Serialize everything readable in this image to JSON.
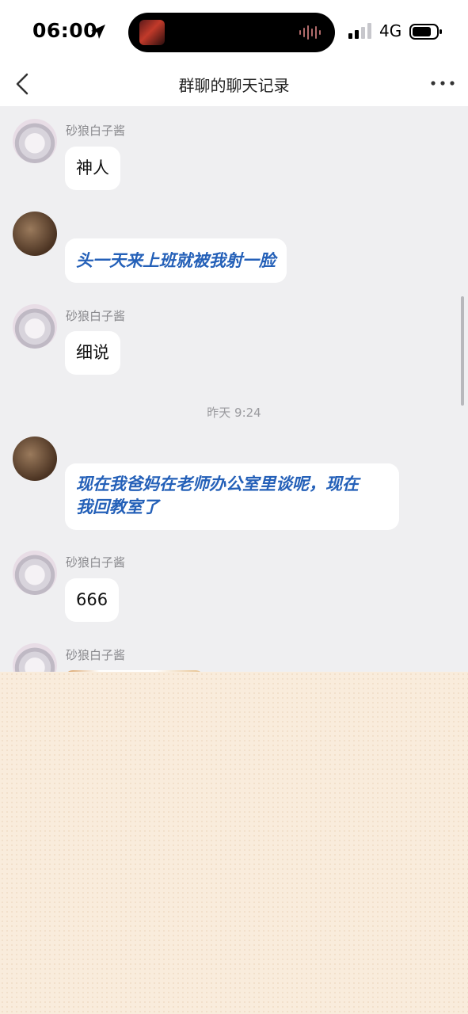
{
  "status_bar": {
    "time": "06:00",
    "network": "4G"
  },
  "nav": {
    "title": "群聊的聊天记录"
  },
  "messages": [
    {
      "sender": "砂狼白子酱",
      "text": "神人"
    },
    {
      "sender": "",
      "text": "头一天来上班就被我射一脸"
    },
    {
      "sender": "砂狼白子酱",
      "text": "细说"
    },
    {
      "timestamp": "昨天 9:24"
    },
    {
      "sender": "",
      "text_lines": [
        "现在我爸妈在老师办公室里谈呢，现在",
        "我回教室了"
      ]
    },
    {
      "sender": "砂狼白子酱",
      "text": "666"
    },
    {
      "sender": "砂狼白子酱"
    }
  ],
  "colors": {
    "chat_background": "#efeff1",
    "link_text": "#2460b8",
    "panel_background": "#f9ecdc"
  },
  "icons": [
    "location-arrow-icon",
    "audio-wave-icon",
    "signal-icon",
    "battery-icon",
    "back-chevron-icon",
    "more-dots-icon"
  ]
}
